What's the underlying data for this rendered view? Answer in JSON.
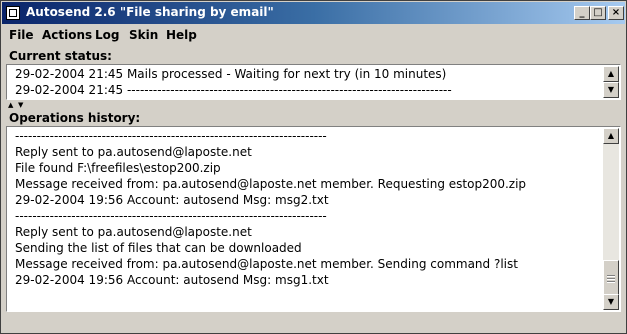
{
  "window": {
    "title": "Autosend 2.6 \"File sharing by email\"",
    "controls": {
      "minimize": "_",
      "maximize": "□",
      "close": "×"
    }
  },
  "menu": {
    "items": [
      "File",
      "Actions",
      "Log",
      "Skin",
      "Help"
    ]
  },
  "current_status": {
    "label": "Current status:",
    "lines": [
      "29-02-2004 21:45 Mails processed - Waiting for next try (in 10 minutes)",
      "29-02-2004 21:45 ---------------------------------------------------------------------------"
    ]
  },
  "splitter": {
    "up_arrow": "▲",
    "down_arrow": "▼"
  },
  "history": {
    "label": "Operations history:",
    "lines": [
      "------------------------------------------------------------------------",
      "Reply sent to pa.autosend@laposte.net",
      "File found F:\\freefiles\\estop200.zip",
      "Message received from: pa.autosend@laposte.net member. Requesting estop200.zip",
      "29-02-2004 19:56 Account: autosend Msg: msg2.txt",
      "------------------------------------------------------------------------",
      "Reply sent to pa.autosend@laposte.net",
      "Sending the list of files that can be downloaded",
      "Message received from: pa.autosend@laposte.net member. Sending command ?list",
      "29-02-2004 19:56 Account: autosend Msg: msg1.txt",
      "",
      "------------------------------------------------------------------------"
    ]
  },
  "scroll": {
    "up": "▲",
    "down": "▼"
  }
}
